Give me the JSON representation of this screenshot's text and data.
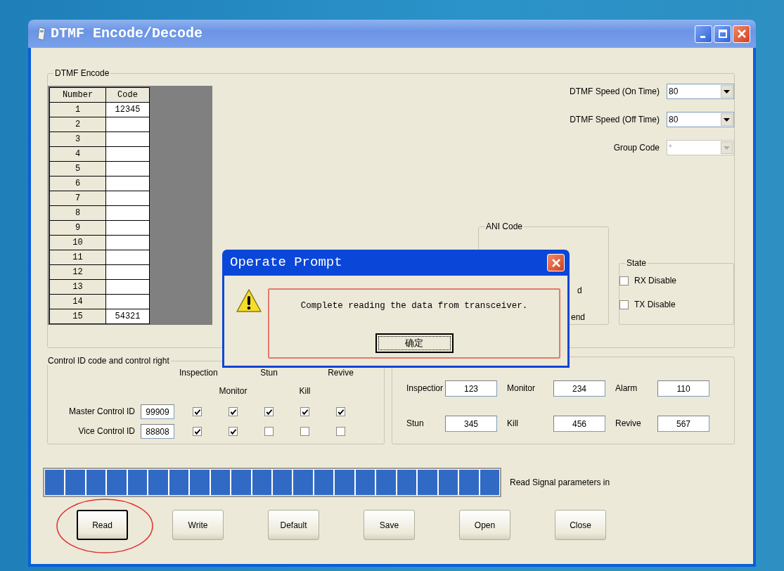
{
  "window": {
    "title": "DTMF Encode/Decode"
  },
  "encode": {
    "title": "DTMF Encode",
    "table": {
      "columns": [
        "Number",
        "Code"
      ],
      "rows": [
        [
          "1",
          "12345"
        ],
        [
          "2",
          ""
        ],
        [
          "3",
          ""
        ],
        [
          "4",
          ""
        ],
        [
          "5",
          ""
        ],
        [
          "6",
          ""
        ],
        [
          "7",
          ""
        ],
        [
          "8",
          ""
        ],
        [
          "9",
          ""
        ],
        [
          "10",
          ""
        ],
        [
          "11",
          ""
        ],
        [
          "12",
          ""
        ],
        [
          "13",
          ""
        ],
        [
          "14",
          ""
        ],
        [
          "15",
          "54321"
        ]
      ]
    },
    "settings": [
      {
        "label": "DTMF Speed (On Time)",
        "value": "80",
        "disabled": false
      },
      {
        "label": "DTMF Speed (Off Time)",
        "value": "80",
        "disabled": false
      },
      {
        "label": "Group Code",
        "value": "*",
        "disabled": true
      }
    ],
    "ani": {
      "title": "ANI Code",
      "texts": [
        "d",
        "end"
      ]
    },
    "state": {
      "title": "State",
      "options": [
        {
          "label": "RX Disable",
          "checked": false
        },
        {
          "label": "TX Disable",
          "checked": false
        }
      ]
    }
  },
  "control": {
    "title": "Control ID code and control right",
    "rights": [
      "Inspection",
      "Monitor",
      "Stun",
      "Kill",
      "Revive"
    ],
    "rows": [
      {
        "label": "Master Control ID",
        "value": "99909",
        "checks": [
          true,
          true,
          true,
          true,
          true
        ]
      },
      {
        "label": "Vice Control ID",
        "value": "88808",
        "checks": [
          true,
          true,
          false,
          false,
          false
        ]
      }
    ]
  },
  "decode": {
    "fields": [
      {
        "label": "Inspectior",
        "value": "123"
      },
      {
        "label": "Monitor",
        "value": "234"
      },
      {
        "label": "Alarm",
        "value": "110"
      },
      {
        "label": "Stun",
        "value": "345"
      },
      {
        "label": "Kill",
        "value": "456"
      },
      {
        "label": "Revive",
        "value": "567"
      }
    ]
  },
  "progress": {
    "level": 1,
    "label": "Read Signal parameters in"
  },
  "buttons": [
    {
      "label": "Read",
      "circled": true
    },
    {
      "label": "Write",
      "circled": false
    },
    {
      "label": "Default",
      "circled": false
    },
    {
      "label": "Save",
      "circled": false
    },
    {
      "label": "Open",
      "circled": false
    },
    {
      "label": "Close",
      "circled": false
    }
  ],
  "dialog": {
    "title": "Operate Prompt",
    "message": "Complete reading the data from transceiver.",
    "button": "确定"
  }
}
